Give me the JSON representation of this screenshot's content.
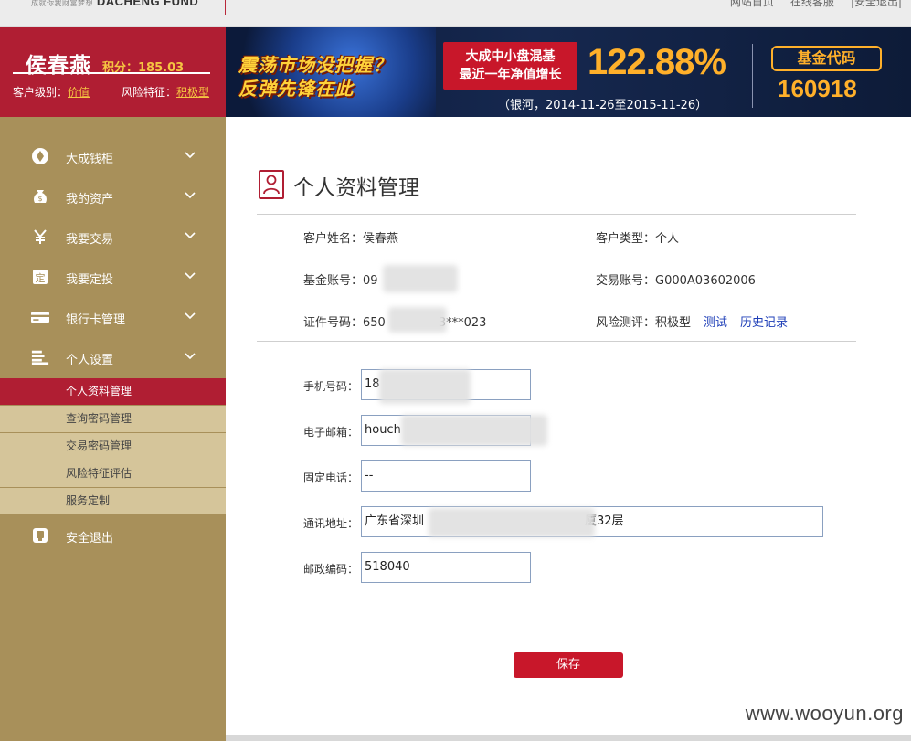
{
  "topbar": {
    "logo_small": "成就你我财富梦想",
    "logo_brand": "DACHENG FUND",
    "nav": [
      "网站首页",
      "在线客服",
      "安全退出"
    ]
  },
  "user": {
    "name": "侯春燕",
    "points_label": "积分：185.03",
    "level_label": "客户级别：",
    "level_value": "价值",
    "risk_label": "风险特征：",
    "risk_value": "积极型"
  },
  "banner": {
    "slogan_line1": "震荡市场没把握？",
    "slogan_line2": "反弹先锋在此",
    "box_line1": "大成中小盘混基",
    "box_line2": "最近一年净值增长",
    "percent": "122.88%",
    "date_range": "（银河，2014-11-26至2015-11-26）",
    "code_label": "基金代码",
    "code_value": "160918"
  },
  "sidebar": {
    "items": [
      {
        "label": "大成钱柜",
        "icon": "coin-icon"
      },
      {
        "label": "我的资产",
        "icon": "money-bag-icon"
      },
      {
        "label": "我要交易",
        "icon": "yen-icon"
      },
      {
        "label": "我要定投",
        "icon": "fixed-invest-icon"
      },
      {
        "label": "银行卡管理",
        "icon": "bank-card-icon"
      },
      {
        "label": "个人设置",
        "icon": "settings-list-icon"
      }
    ],
    "subitems": [
      {
        "label": "个人资料管理",
        "active": true
      },
      {
        "label": "查询密码管理",
        "active": false
      },
      {
        "label": "交易密码管理",
        "active": false
      },
      {
        "label": "风险特征评估",
        "active": false
      },
      {
        "label": "服务定制",
        "active": false
      }
    ],
    "logout_label": "安全退出"
  },
  "page": {
    "title": "个人资料管理"
  },
  "info": {
    "name": "客户姓名：侯春燕",
    "type": "客户类型：个人",
    "fund_account": "基金账号：09",
    "trade_account": "交易账号：G000A03602006",
    "id_prefix": "证件号码：650",
    "id_suffix": "3***023",
    "risk": "风险测评：积极型",
    "risk_test_link": "测试",
    "risk_history_link": "历史记录"
  },
  "form": {
    "mobile_label": "手机号码：",
    "mobile_value": "18",
    "email_label": "电子邮箱：",
    "email_value": "houch",
    "phone_label": "固定电话：",
    "phone_value": "--",
    "address_label": "通讯地址：",
    "address_prefix": "广东省深圳",
    "address_suffix": "厦32层",
    "zip_label": "邮政编码：",
    "zip_value": "518040",
    "save_label": "保存"
  },
  "watermark": "www.wooyun.org",
  "colors": {
    "brand_red": "#b01e33",
    "sidebar_gold": "#a8905a",
    "submenu_beige": "#d5c59a",
    "banner_orange": "#ffb02a",
    "link_blue": "#1f3fb8"
  }
}
